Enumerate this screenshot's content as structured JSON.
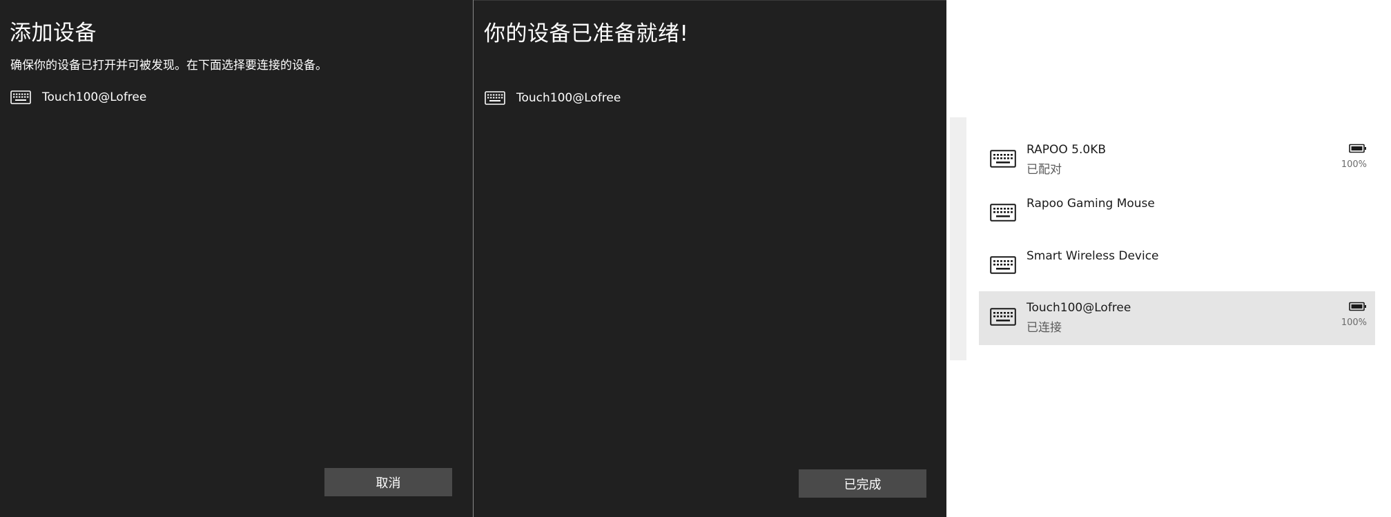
{
  "add_dialog": {
    "title": "添加设备",
    "subtitle": "确保你的设备已打开并可被发现。在下面选择要连接的设备。",
    "device": {
      "name": "Touch100@Lofree",
      "icon": "keyboard-icon"
    },
    "cancel_label": "取消"
  },
  "ready_dialog": {
    "title": "你的设备已准备就绪!",
    "device": {
      "name": "Touch100@Lofree",
      "icon": "keyboard-icon"
    },
    "done_label": "已完成"
  },
  "device_list": {
    "items": [
      {
        "name": "RAPOO 5.0KB",
        "status": "已配对",
        "battery": "100%",
        "icon": "keyboard-icon"
      },
      {
        "name": "Rapoo Gaming Mouse",
        "status": "",
        "battery": "",
        "icon": "keyboard-icon"
      },
      {
        "name": "Smart Wireless Device",
        "status": "",
        "battery": "",
        "icon": "keyboard-icon"
      },
      {
        "name": "Touch100@Lofree",
        "status": "已连接",
        "battery": "100%",
        "icon": "keyboard-icon"
      }
    ]
  },
  "colors": {
    "dialog_bg": "#202020",
    "button_bg": "#4a4a4a",
    "selected_row": "#e5e5e5"
  }
}
